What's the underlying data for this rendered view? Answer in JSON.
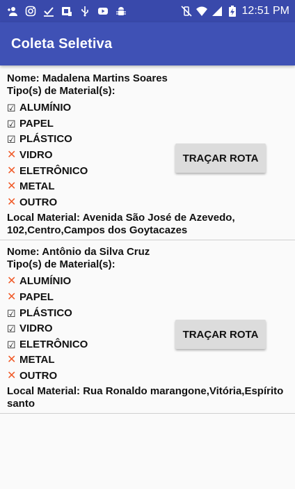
{
  "status_bar": {
    "time": "12:51 PM",
    "left_icons": [
      "person-add-icon",
      "instagram-icon",
      "download-done-icon",
      "sim-card-icon",
      "usb-icon",
      "youtube-icon",
      "android-debug-icon"
    ],
    "right_icons": [
      "vibrate-off-icon",
      "wifi-icon",
      "signal-icon",
      "battery-charging-icon"
    ]
  },
  "app_bar": {
    "title": "Coleta Seletiva"
  },
  "labels": {
    "tipo": "Tipo(s) de Material(s):",
    "button": "TRAÇAR ROTA"
  },
  "cards": [
    {
      "nome": "Nome: Madalena Martins Soares",
      "materials": [
        {
          "label": "ALUMÍNIO",
          "checked": true
        },
        {
          "label": "PAPEL",
          "checked": true
        },
        {
          "label": "PLÁSTICO",
          "checked": true
        },
        {
          "label": "VIDRO",
          "checked": false
        },
        {
          "label": "ELETRÔNICO",
          "checked": false
        },
        {
          "label": "METAL",
          "checked": false
        },
        {
          "label": "OUTRO",
          "checked": false
        }
      ],
      "local": "Local Material: Avenida São José de Azevedo, 102,Centro,Campos dos Goytacazes"
    },
    {
      "nome": "Nome: Antônio da Silva Cruz",
      "materials": [
        {
          "label": "ALUMÍNIO",
          "checked": false
        },
        {
          "label": "PAPEL",
          "checked": false
        },
        {
          "label": "PLÁSTICO",
          "checked": true
        },
        {
          "label": "VIDRO",
          "checked": true
        },
        {
          "label": "ELETRÔNICO",
          "checked": true
        },
        {
          "label": "METAL",
          "checked": false
        },
        {
          "label": "OUTRO",
          "checked": false
        }
      ],
      "local": "Local Material: Rua Ronaldo marangone,Vitória,Espírito santo"
    }
  ],
  "marks": {
    "checked": "☑",
    "unchecked": "✕"
  },
  "colors": {
    "status_bar": "#3949ab",
    "app_bar": "#3f51b5",
    "cross": "#f05a28",
    "button": "#dcdcdc"
  }
}
